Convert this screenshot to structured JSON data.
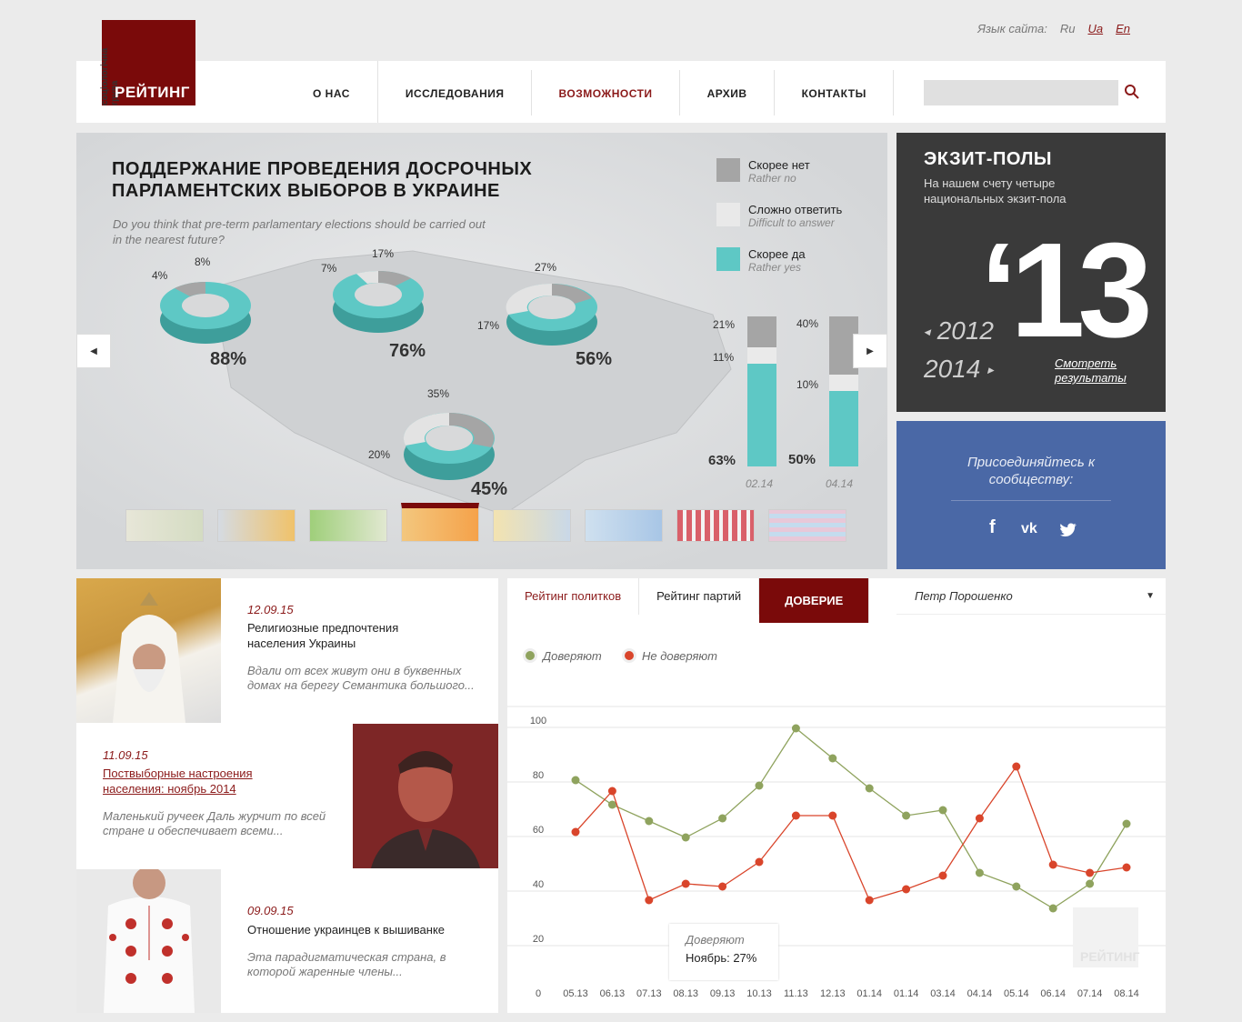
{
  "lang_switch": {
    "label": "Язык сайта:",
    "ru": "Ru",
    "ua": "Ua",
    "en": "En"
  },
  "logo": {
    "vertical": "соціологічна група",
    "name": "РЕЙТИНГ"
  },
  "menu": [
    "О НАС",
    "ИССЛЕДОВАНИЯ",
    "ВОЗМОЖНОСТИ",
    "АРХИВ",
    "КОНТАКТЫ"
  ],
  "search": {
    "placeholder": ""
  },
  "hero": {
    "title": "ПОДДЕРЖАНИЕ ПРОВЕДЕНИЯ ДОСРОЧНЫХ ПАРЛАМЕНТСКИХ ВЫБОРОВ В УКРАИНЕ",
    "question": "Do you think that pre-term parlamentary elections should be carried out in the nearest future?",
    "legend": [
      {
        "ru": "Скорее нет",
        "en": "Rather no",
        "color": "#a5a5a5"
      },
      {
        "ru": "Сложно ответить",
        "en": "Difficult to answer",
        "color": "#e9e9e9"
      },
      {
        "ru": "Скорее да",
        "en": "Rather yes",
        "color": "#5ec8c5"
      }
    ],
    "donuts": [
      {
        "yes": "88%",
        "no": "8%",
        "hard": "4%"
      },
      {
        "yes": "76%",
        "no": "17%",
        "hard": "7%"
      },
      {
        "yes": "56%",
        "no": "27%",
        "hard": "17%"
      },
      {
        "yes": "45%",
        "no": "35%",
        "hard": "20%"
      }
    ],
    "bars": [
      {
        "date": "02.14",
        "no": "21%",
        "hard": "11%",
        "yes": "63%"
      },
      {
        "date": "04.14",
        "no": "40%",
        "hard": "10%",
        "yes": "50%"
      }
    ]
  },
  "exit": {
    "title": "ЭКЗИТ-ПОЛЫ",
    "desc": "На нашем счету четыре национальных экзит-пола",
    "year": "‘13",
    "prev": "2012",
    "next": "2014",
    "link": "Смотреть результаты"
  },
  "community": {
    "text": "Присоединяйтесь к сообществу:",
    "fb": "f",
    "vk": "vk",
    "tw": "twitter"
  },
  "news": [
    {
      "date": "12.09.15",
      "title": "Религиозные предпочтения населения Украины",
      "text": "Вдали от всех живут они в буквенных домах на берегу Семантика большого..."
    },
    {
      "date": "11.09.15",
      "title": "Поствыборные настроения населения: ноябрь 2014",
      "text": "Маленький ручеек Даль журчит по всей стране и обеспечивает всеми..."
    },
    {
      "date": "09.09.15",
      "title": "Отношение украинцев к вышиванке",
      "text": "Эта парадигматическая страна, в которой жаренные члены..."
    }
  ],
  "tabs": [
    "Рейтинг политков",
    "Рейтинг партий",
    "ДОВЕРИЕ"
  ],
  "dropdown": "Петр Порошенко",
  "tooltip": {
    "label": "Доверяют",
    "value": "Ноябрь: 27%"
  },
  "watermark": "РЕЙТИНГ",
  "chart_data": {
    "type": "line",
    "x": [
      "05.13",
      "06.13",
      "07.13",
      "08.13",
      "09.13",
      "10.13",
      "11.13",
      "12.13",
      "01.14",
      "01.14",
      "03.14",
      "04.14",
      "05.14",
      "06.14",
      "07.14",
      "08.14"
    ],
    "series": [
      {
        "name": "Доверяют",
        "color": "#8fa35e",
        "values": [
          78,
          69,
          63,
          57,
          64,
          76,
          97,
          86,
          75,
          65,
          67,
          44,
          39,
          31,
          40,
          62
        ]
      },
      {
        "name": "Не доверяют",
        "color": "#d9452b",
        "values": [
          59,
          74,
          34,
          40,
          39,
          48,
          65,
          65,
          34,
          38,
          43,
          64,
          83,
          47,
          44,
          46
        ]
      }
    ],
    "yticks": [
      "100",
      "80",
      "60",
      "40",
      "20",
      "0"
    ],
    "ylim": [
      0,
      100
    ]
  }
}
